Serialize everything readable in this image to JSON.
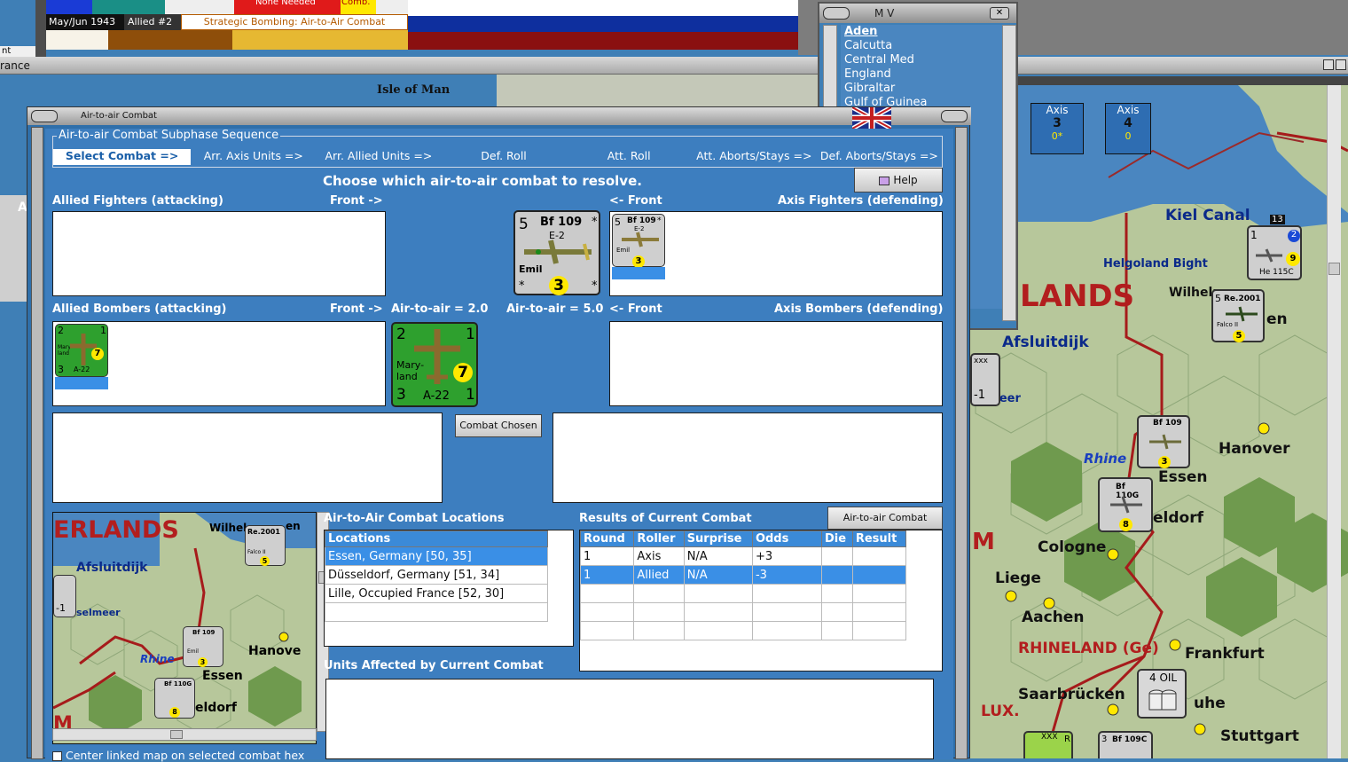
{
  "top_strip": {
    "date": "May/Jun 1943",
    "allied": "Allied #2",
    "phase_text": "Strategic Bombing: Air-to-Air Combat",
    "none_needed": "None Needed",
    "comb": "Comb.",
    "side_char": "nt"
  },
  "window2_title": "rance",
  "mv": {
    "title": "M V",
    "items": [
      "Aden",
      "Calcutta",
      "Central Med",
      "England",
      "Gibraltar",
      "Gulf of Guinea"
    ]
  },
  "axis_tiles": [
    {
      "label": "Axis",
      "value": "3",
      "sub": "0*"
    },
    {
      "label": "Axis",
      "value": "4",
      "sub": "0"
    }
  ],
  "map_labels": {
    "isle_of_man": "Isle of Man",
    "kiel": "Kiel Canal",
    "helgoland": "Helgoland Bight",
    "lands": "LANDS",
    "wilhelm": "Wilhelm",
    "afsluitdijk": "Afsluitdijk",
    "ijsselmeer": "elmeer",
    "rhine": "Rhine",
    "hanover": "Hanover",
    "essen": "Essen",
    "dusseldorf": "eldorf",
    "cologne": "Cologne",
    "liege": "Liege",
    "aachen": "Aachen",
    "rhineland": "RHINELAND (Ge)",
    "frankfurt": "Frankfurt",
    "saarbrucken": "Saarbrücken",
    "lux": "LUX.",
    "karlsruhe": "uhe",
    "stuttgart": "Stuttgart",
    "oil": "4 OIL",
    "a": "A",
    "en": "en",
    "m": "M"
  },
  "dialog": {
    "title": "Air-to-air Combat",
    "sequence_title": "Air-to-air Combat Subphase Sequence",
    "steps": [
      "Select Combat =>",
      "Arr. Axis Units =>",
      "Arr. Allied Units =>",
      "Def. Roll",
      "Att. Roll",
      "Att. Aborts/Stays =>",
      "Def. Aborts/Stays =>"
    ],
    "instruction": "Choose which air-to-air combat to resolve.",
    "help": "Help",
    "allied_fighters": "Allied Fighters (attacking)",
    "front_right": "Front ->",
    "front_left": "<- Front",
    "axis_fighters": "Axis Fighters (defending)",
    "allied_bombers": "Allied Bombers (attacking)",
    "axis_bombers": "Axis Bombers (defending)",
    "ata_allied": "Air-to-air = 2.0",
    "ata_axis": "Air-to-air = 5.0",
    "combat_chosen": "Combat Chosen",
    "locations_title": "Air-to-Air Combat Locations",
    "locations_header": "Locations",
    "locations": [
      "Essen, Germany [50, 35]",
      "Düsseldorf, Germany [51, 34]",
      "Lille, Occupied France [52, 30]"
    ],
    "results_title": "Results of Current Combat",
    "chart_button": "Air-to-air Combat Chart",
    "results_headers": [
      "Round",
      "Roller",
      "Surprise",
      "Odds",
      "Die",
      "Result"
    ],
    "results_rows": [
      [
        "1",
        "Axis",
        "N/A",
        "+3",
        "",
        ""
      ],
      [
        "1",
        "Allied",
        "N/A",
        "-3",
        "",
        ""
      ]
    ],
    "units_affected_title": "Units Affected by Current Combat",
    "center_checkbox": "Center linked map on selected combat hex"
  },
  "counters": {
    "bf109": {
      "name": "Bf 109",
      "model": "E-2",
      "nick": "Emil",
      "left": "5",
      "factor": "3",
      "star": "*"
    },
    "maryland": {
      "tl": "2",
      "tr": "1",
      "bl": "3",
      "br": "1",
      "name": "Mary-land",
      "model": "A-22",
      "factor": "7"
    },
    "re2001": {
      "num": "5",
      "name": "Re.2001",
      "nick": "Falco II",
      "factor": "5"
    },
    "bf110": {
      "num": "5",
      "name": "Bf 110G",
      "factor": "8"
    },
    "he115": {
      "name": "He 115C",
      "tl": "1",
      "tr": "2",
      "br": "2",
      "factor": "9",
      "top": "13"
    },
    "bf109c": {
      "name": "Bf 109C",
      "num": "3"
    },
    "xxx": {
      "label": "xxx",
      "val": "-1"
    },
    "r_counter": {
      "label": "XXX",
      "r": "R"
    }
  },
  "mini_map": {
    "lands": "ERLANDS",
    "wilhel": "Wilhel",
    "afsluitdijk": "Afsluitdijk",
    "ijsselmeer": "selmeer",
    "rhine": "Rhine",
    "hanover": "Hanove",
    "essen": "Essen",
    "dusseldorf": "eldorf",
    "xxx_val": "-1",
    "m": "M",
    "en": "en"
  },
  "colors": {
    "dialog": "#3d7ebf",
    "select": "#3a8fe6",
    "counter_green": "#2ea02e",
    "counter_gray": "#c8c8c8"
  }
}
